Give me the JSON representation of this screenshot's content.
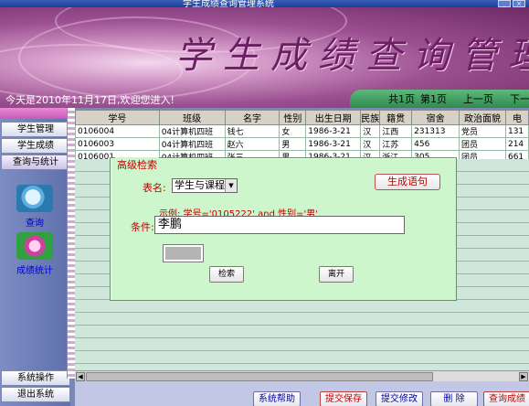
{
  "window": {
    "title": "学生成绩查询管理系统"
  },
  "banner": {
    "title": "学生成绩查询管理",
    "welcome": "今天是2010年11月17日,欢迎您进入!"
  },
  "pager": {
    "total_pages": "共1页",
    "current_page": "第1页",
    "prev": "上一页",
    "next": "下一页"
  },
  "sidebar": {
    "items": [
      {
        "label": "学生管理"
      },
      {
        "label": "学生成绩"
      },
      {
        "label": "查询与统计"
      }
    ],
    "tools": [
      {
        "label": "查询",
        "icon": "magnifier-icon"
      },
      {
        "label": "成绩统计",
        "icon": "statistics-icon"
      }
    ],
    "bottom_items": [
      {
        "label": "系统操作"
      },
      {
        "label": "退出系统"
      }
    ]
  },
  "grid": {
    "columns": [
      "学号",
      "班级",
      "名字",
      "性别",
      "出生日期",
      "民族",
      "籍贯",
      "宿舍",
      "政治面貌",
      "电"
    ],
    "rows": [
      [
        "0106004",
        "04计算机四班",
        "钱七",
        "女",
        "1986-3-21",
        "汉",
        "江西",
        "231313",
        "党员",
        "131"
      ],
      [
        "0106003",
        "04计算机四班",
        "赵六",
        "男",
        "1986-3-21",
        "汉",
        "江苏",
        "456",
        "团员",
        "214"
      ],
      [
        "0106001",
        "04计算机四班",
        "张三",
        "男",
        "1986-3-21",
        "汉",
        "浙江",
        "305",
        "团员",
        "661"
      ]
    ]
  },
  "dialog": {
    "title": "高级检索",
    "table_label": "表名:",
    "table_value": "学生与课程",
    "generate_button": "生成语句",
    "example": "示例: 学号='0105222' and 性别='男'",
    "condition_label": "条件:",
    "condition_value": "李鹏",
    "search_button": "检索",
    "exit_button": "离开"
  },
  "bottom": {
    "buttons": [
      {
        "label": "系统帮助",
        "style": "blue"
      },
      {
        "label": "提交保存",
        "style": "red"
      },
      {
        "label": "提交修改",
        "style": "blue"
      },
      {
        "label": "删 除",
        "style": "blue"
      },
      {
        "label": "查询成绩",
        "style": "red"
      }
    ]
  }
}
